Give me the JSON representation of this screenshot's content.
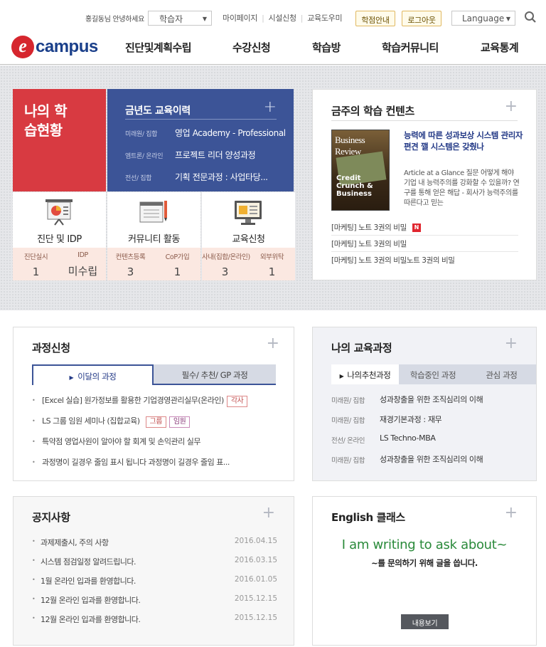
{
  "util": {
    "greeting": "홍길동님 안녕하세요",
    "role_value": "학습자",
    "links": [
      "마이페이지",
      "시설신청",
      "교육도우미"
    ],
    "credit_btn": "학점안내",
    "logout_btn": "로그아웃",
    "language_value": "Language"
  },
  "header": {
    "logo_letter": "e",
    "logo_text": "campus",
    "nav": [
      "진단및계획수립",
      "수강신청",
      "학습방",
      "학습커뮤니티",
      "교육통계"
    ]
  },
  "status": {
    "title": "나의 학습현황",
    "history": {
      "title": "금년도 교육이력",
      "items": [
        {
          "category": "미래원/ 집합",
          "name": "영업 Academy - Professional"
        },
        {
          "category": "엠트론/ 온라인",
          "name": "프로젝트 리더 양성과정"
        },
        {
          "category": "전선/ 집합",
          "name": "기획 전문과정 : 사업타당..."
        }
      ]
    },
    "tiles": [
      {
        "label": "진단 및 IDP",
        "icon": "presentation-chart-icon",
        "stats": [
          {
            "k": "진단실시",
            "v": "1"
          },
          {
            "k": "IDP",
            "v": "미수립"
          }
        ]
      },
      {
        "label": "커뮤니티 활동",
        "icon": "notebook-pencil-icon",
        "stats": [
          {
            "k": "컨텐츠등록",
            "v": "3"
          },
          {
            "k": "CoP가입",
            "v": "1"
          }
        ]
      },
      {
        "label": "교육신청",
        "icon": "monitor-icon",
        "stats": [
          {
            "k": "사내(집합/온라인)",
            "v": "3"
          },
          {
            "k": "외부위탁",
            "v": "1"
          }
        ]
      }
    ]
  },
  "weekly": {
    "title": "금주의 학습 컨텐츠",
    "cover_title": "Business Review",
    "cover_subtitle": "Credit Crunch & Business",
    "book_title": "능력에 따른 성과보상 시스템 관리자 편견 깰 시스템은 갖췄나",
    "book_desc": "Article at a Glance 질문 어떻게 해야 기업 내 능력주의를 강화할 수 있을까? 연구를 통해 얻은 해답 - 회사가 능력주의를 따른다고 믿는",
    "items": [
      {
        "text": "[마케팅] 노트 3권의 비밀",
        "badge": "N"
      },
      {
        "text": "[마케팅] 노트 3권의 비밀",
        "badge": ""
      },
      {
        "text": "[마케팅] 노트 3권의 비밀노트 3권의 비밀",
        "badge": ""
      }
    ]
  },
  "apply": {
    "title": "과정신청",
    "tabs": [
      "이달의 과정",
      "필수/ 추천/ GP 과정"
    ],
    "items": [
      {
        "text": "[Excel 실습] 원가정보를 활용한 기업경영관리실무(온라인)",
        "tags": [
          "각사"
        ]
      },
      {
        "text": "LS 그룹 임원 세미나 (집합교육)",
        "tags": [
          "그룹",
          "임원"
        ]
      },
      {
        "text": "특약점 영업사원이 알아야 할 회계 및 손익관리 실무",
        "tags": []
      },
      {
        "text": "과정명이 길경우 줄임 표시 됩니다 과정명이 길경우 줄임 표...",
        "tags": []
      }
    ]
  },
  "mycourse": {
    "title": "나의 교육과정",
    "tabs": [
      "나의추천과정",
      "학습중인 과정",
      "관심 과정"
    ],
    "items": [
      {
        "category": "미래원/ 집합",
        "name": "성과창출을 위한 조직심리의 이해"
      },
      {
        "category": "미래원/ 집합",
        "name": "재경기본과정 : 재무"
      },
      {
        "category": "전선/ 온라인",
        "name": "LS Techno-MBA"
      },
      {
        "category": "미래원/ 집합",
        "name": "성과창출을 위한 조직심리의 이해"
      }
    ]
  },
  "notice": {
    "title": "공지사항",
    "items": [
      {
        "text": "과제제출시, 주의 사항",
        "date": "2016.04.15"
      },
      {
        "text": "시스템 점검일정 알려드립니다.",
        "date": "2016.03.15"
      },
      {
        "text": "1월 온라인 입과를 환영합니다.",
        "date": "2016.01.05"
      },
      {
        "text": "12월 온라인 입과를 환영합니다.",
        "date": "2015.12.15"
      },
      {
        "text": "12월 온라인 입과를 환영합니다.",
        "date": "2015.12.15"
      }
    ]
  },
  "english": {
    "title": "English 클래스",
    "sentence": "I am writing to ask about~",
    "translation": "~를 문의하기 위해 글을 씁니다.",
    "view_btn": "내용보기"
  },
  "colors": {
    "red": "#d83a41",
    "navy": "#3c5497",
    "green": "#2a8a3a",
    "gold": "#e0b860"
  }
}
